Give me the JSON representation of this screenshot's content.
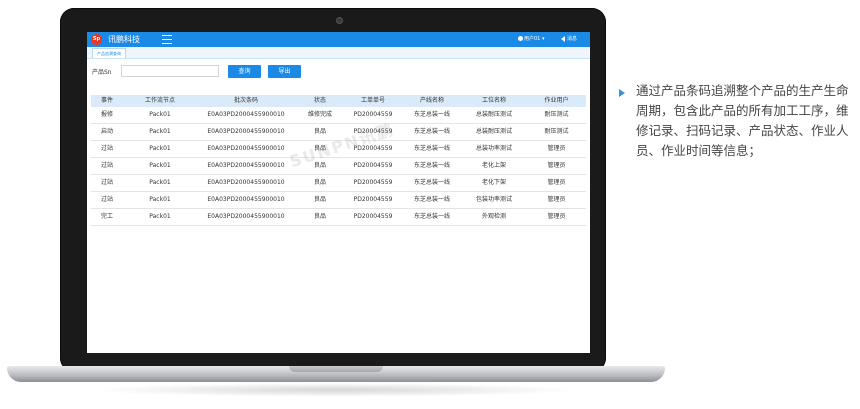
{
  "app": {
    "logo_text": "Sp",
    "title": "讯鹏科技",
    "user": "用户01",
    "message": "消息"
  },
  "tabs": [
    {
      "label": "产品追溯查询"
    }
  ],
  "search": {
    "label": "产品Sn",
    "value": "",
    "query_button": "查询",
    "export_button": "导出"
  },
  "table": {
    "columns": [
      "事件",
      "工作流节点",
      "批次条码",
      "状态",
      "工单单号",
      "产线名称",
      "工位名称",
      "作业用户"
    ],
    "rows": [
      [
        "报修",
        "Pack01",
        "E0A03PD2000455900010",
        "维修完成",
        "PD20004559",
        "东芝总装一线",
        "总装耐压测试",
        "耐压测试"
      ],
      [
        "启动",
        "Pack01",
        "E0A03PD2000455900010",
        "良品",
        "PD20004559",
        "东芝总装一线",
        "总装耐压测试",
        "耐压测试"
      ],
      [
        "过站",
        "Pack01",
        "E0A03PD2000455900010",
        "良品",
        "PD20004559",
        "东芝总装一线",
        "总装功率测试",
        "管理员"
      ],
      [
        "过站",
        "Pack01",
        "E0A03PD2000455900010",
        "良品",
        "PD20004559",
        "东芝总装一线",
        "老化上架",
        "管理员"
      ],
      [
        "过站",
        "Pack01",
        "E0A03PD2000455900010",
        "良品",
        "PD20004559",
        "东芝总装一线",
        "老化下架",
        "管理员"
      ],
      [
        "过站",
        "Pack01",
        "E0A03PD2000455900010",
        "良品",
        "PD20004559",
        "东芝总装一线",
        "包装功率测试",
        "管理员"
      ],
      [
        "完工",
        "Pack01",
        "E0A03PD2000455900010",
        "良品",
        "PD20004559",
        "东芝总装一线",
        "外观检测",
        "管理员"
      ]
    ]
  },
  "watermark": "SUNPN讯鹏",
  "side_note": "通过产品条码追溯整个产品的生产生命周期，包含此产品的所有加工工序，维修记录、扫码记录、产品状态、作业人员、作业时间等信息；",
  "colors": {
    "accent": "#1a8ae6",
    "header_row": "#daeaf8",
    "bullet": "#3d8fd9"
  }
}
